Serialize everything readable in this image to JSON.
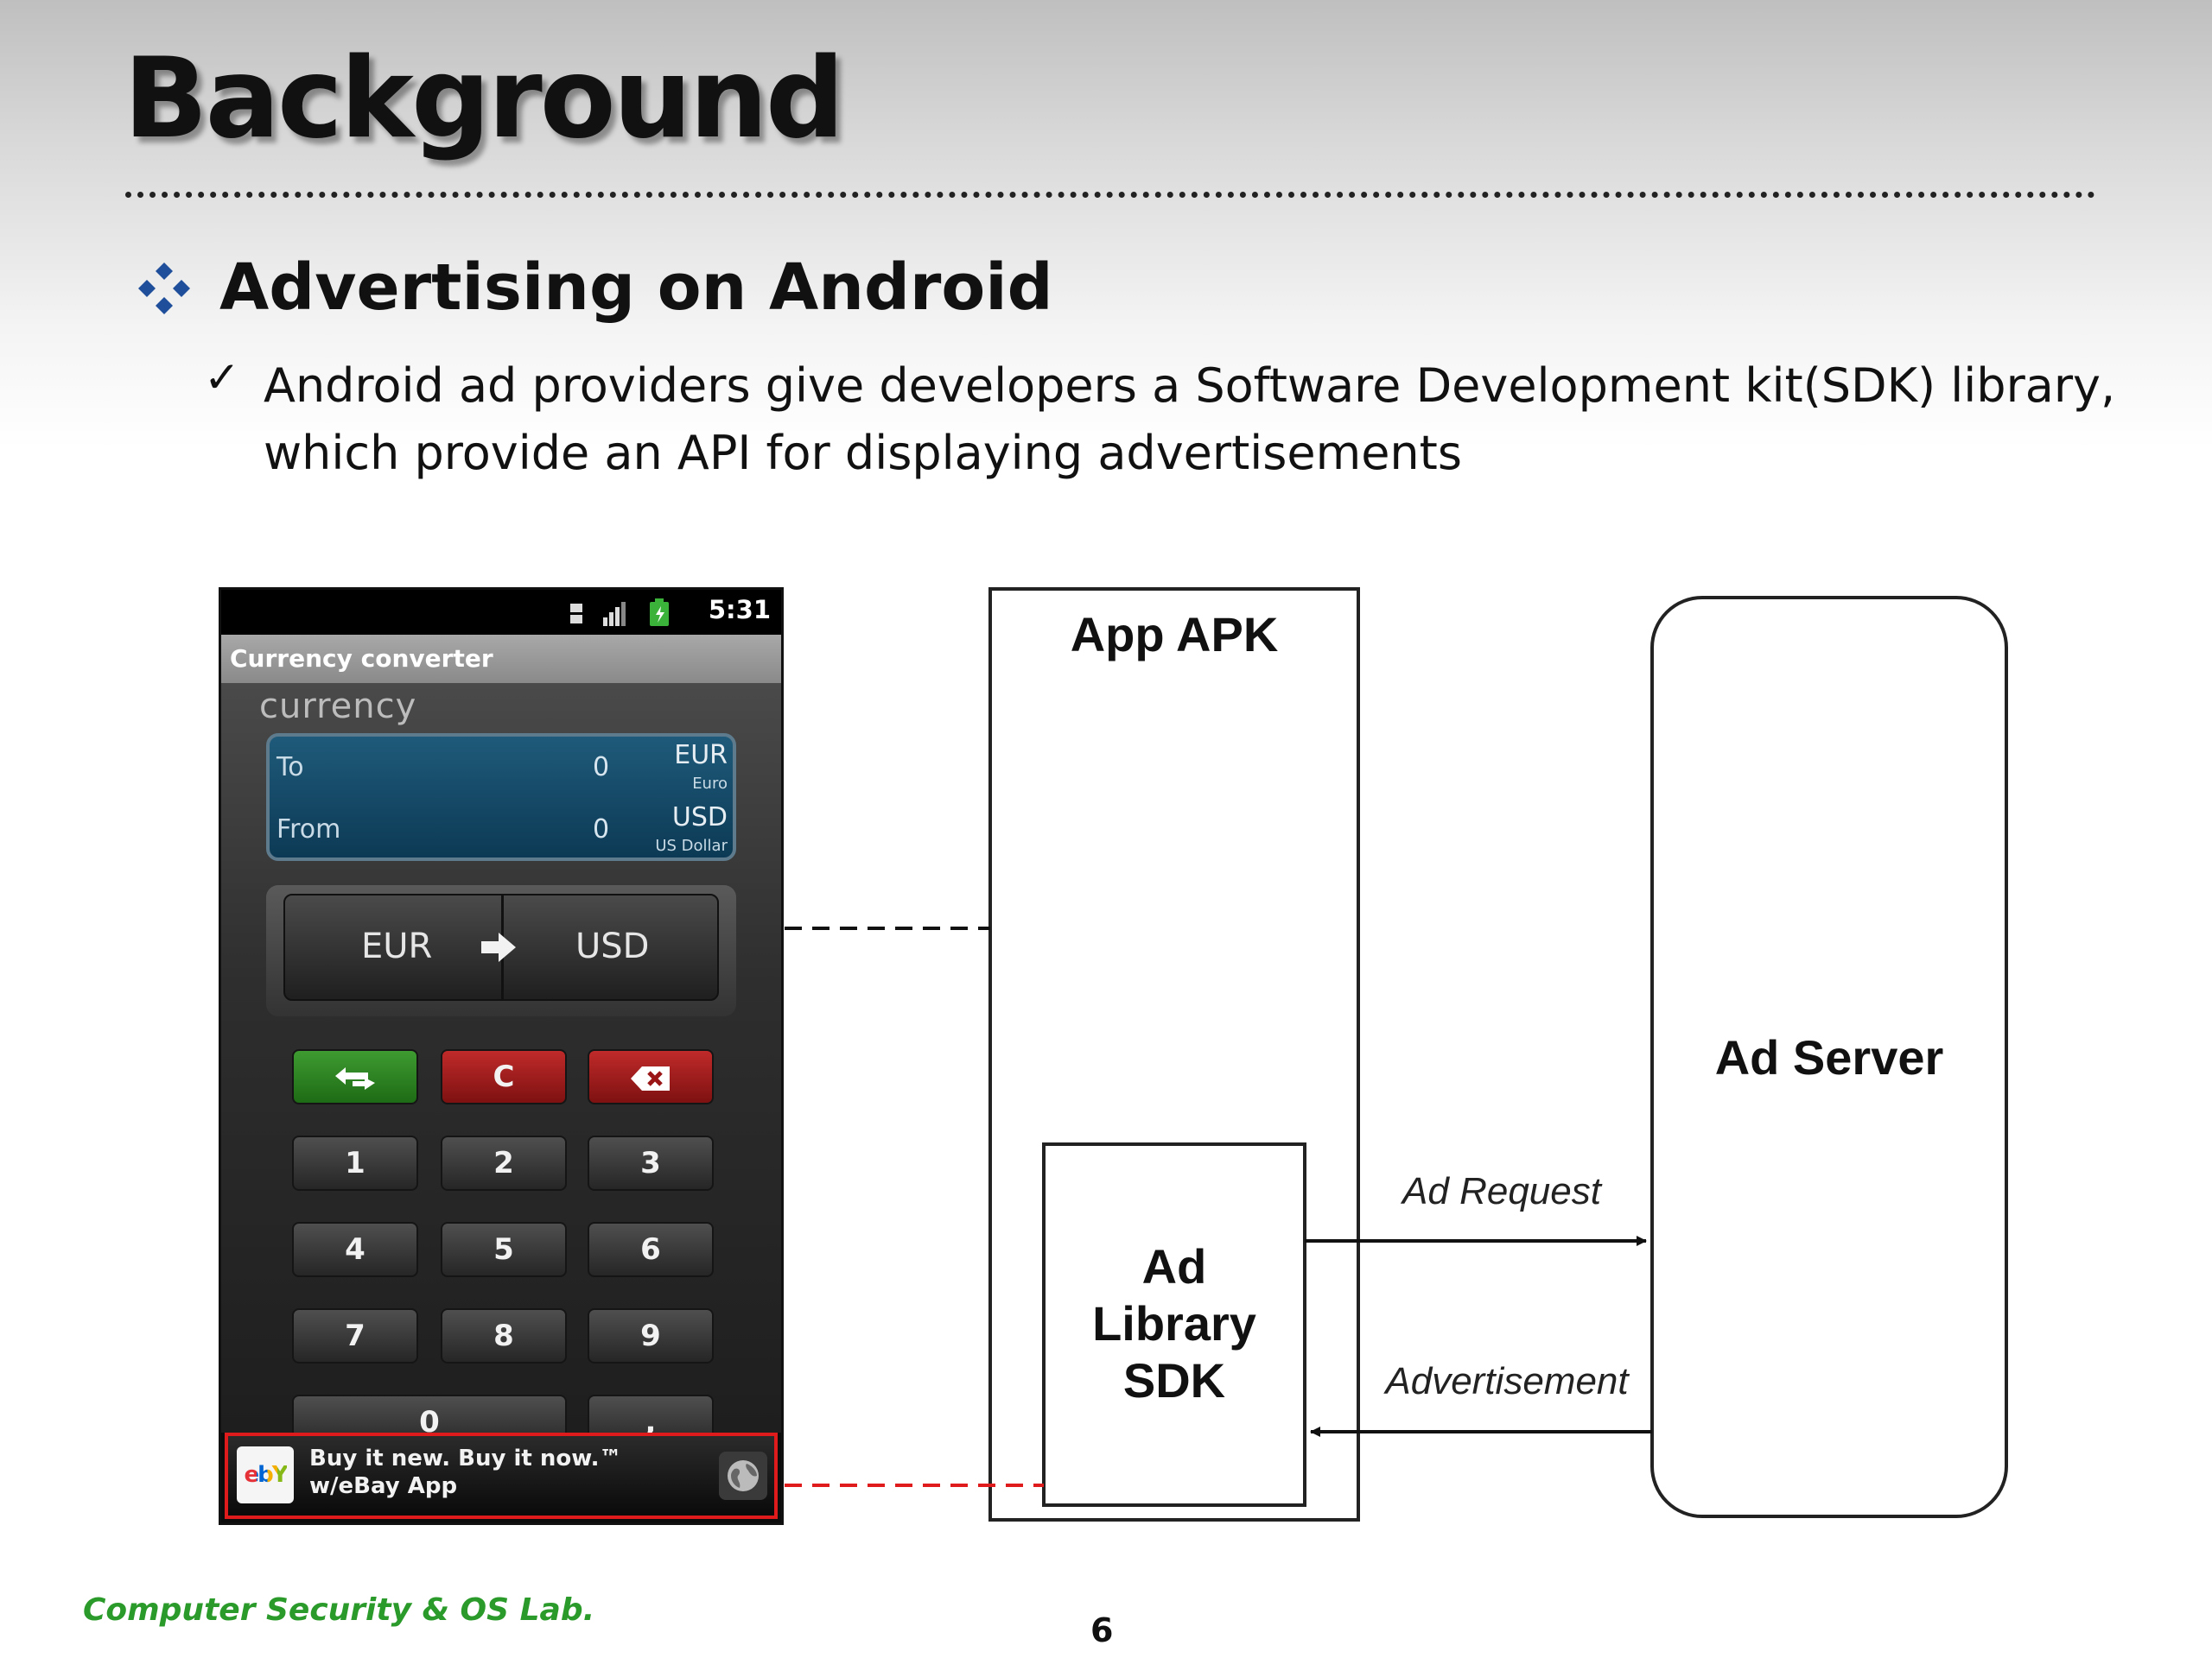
{
  "slide": {
    "title": "Background",
    "bullet1": "Advertising on Android",
    "bullet2_check": "✓",
    "bullet2": "Android ad providers give developers a Software Development kit(SDK) library, which provide an API for displaying advertisements"
  },
  "phone": {
    "status_time": "5:31",
    "app_title": "Currency converter",
    "brand": "currency",
    "display": {
      "to_label": "To",
      "to_value": "0",
      "to_currency": "EUR",
      "to_currency_name": "Euro",
      "from_label": "From",
      "from_value": "0",
      "from_currency": "USD",
      "from_currency_name": "US Dollar"
    },
    "pair": {
      "from": "EUR",
      "to": "USD"
    },
    "keys": {
      "clear": "C",
      "k1": "1",
      "k2": "2",
      "k3": "3",
      "k4": "4",
      "k5": "5",
      "k6": "6",
      "k7": "7",
      "k8": "8",
      "k9": "9",
      "k0": "0",
      "kdot": ","
    },
    "ad": {
      "logo": "ebY",
      "text": "Buy it new. Buy it now.™ w/eBay App"
    }
  },
  "diagram": {
    "app_apk": "App APK",
    "ad_library": [
      "Ad",
      "Library",
      "SDK"
    ],
    "ad_server": "Ad Server",
    "ad_request": "Ad Request",
    "advertisement": "Advertisement"
  },
  "colors": {
    "ad_link": "#e01b1b",
    "footer_green": "#2a9a2a",
    "bullet_blue": "#1f4e9a"
  },
  "footer": {
    "left": "Computer Security & OS Lab.",
    "page": "6"
  }
}
